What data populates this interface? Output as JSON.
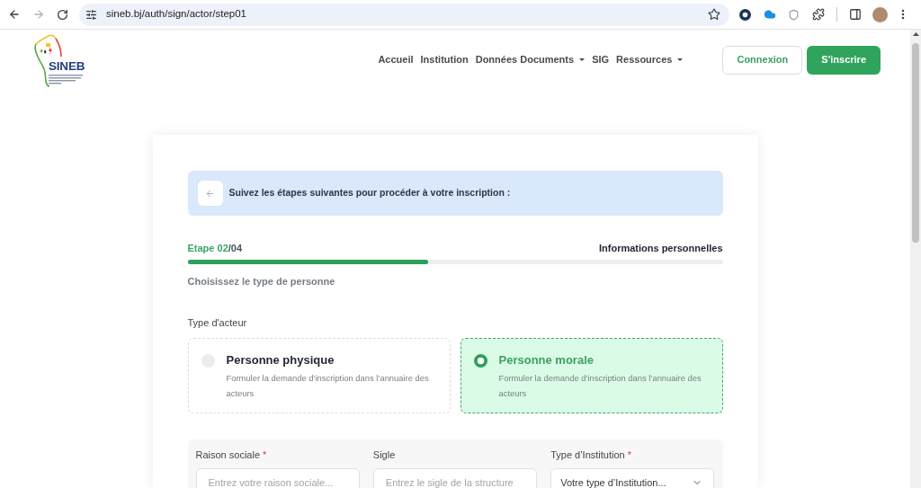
{
  "browser": {
    "url": "sineb.bj/auth/sign/actor/step01"
  },
  "header": {
    "logo": {
      "name": "SINEB"
    },
    "nav": [
      {
        "label": "Accueil",
        "dropdown": false
      },
      {
        "label": "Institution",
        "dropdown": false
      },
      {
        "label": "Données Documents",
        "dropdown": true
      },
      {
        "label": "SIG",
        "dropdown": false
      },
      {
        "label": "Ressources",
        "dropdown": true
      }
    ],
    "buttons": [
      {
        "label": "Connexion",
        "kind": "outline"
      },
      {
        "label": "S'inscrire",
        "kind": "primary"
      }
    ]
  },
  "banner": {
    "text": "Suivez les étapes suivantes pour procéder à votre inscription :"
  },
  "progress": {
    "step": "Etape 02",
    "total": "/04",
    "title": "Informations personnelles",
    "level": 0.45
  },
  "subtitle": "Choisissez le type de personne",
  "actor_type": {
    "label": "Type d'acteur",
    "options": [
      {
        "title": "Personne physique",
        "description": "Formuler la demande d’inscription dans l’annuaire des acteurs",
        "selected": false
      },
      {
        "title": "Personne morale",
        "description": "Formuler la demande d’inscription dans l’annuaire des acteurs",
        "selected": true
      }
    ]
  },
  "form": {
    "fields": [
      {
        "label": "Raison sociale",
        "required_mark": "*",
        "kind": "text",
        "placeholder": "Entrez votre raison sociale..."
      },
      {
        "label": "Sigle",
        "kind": "text",
        "placeholder": "Entrez le sigle de la structure"
      },
      {
        "label": "Type d’Institution",
        "required_mark": "*",
        "kind": "select",
        "value": "Votre type d’Institution..."
      }
    ]
  }
}
